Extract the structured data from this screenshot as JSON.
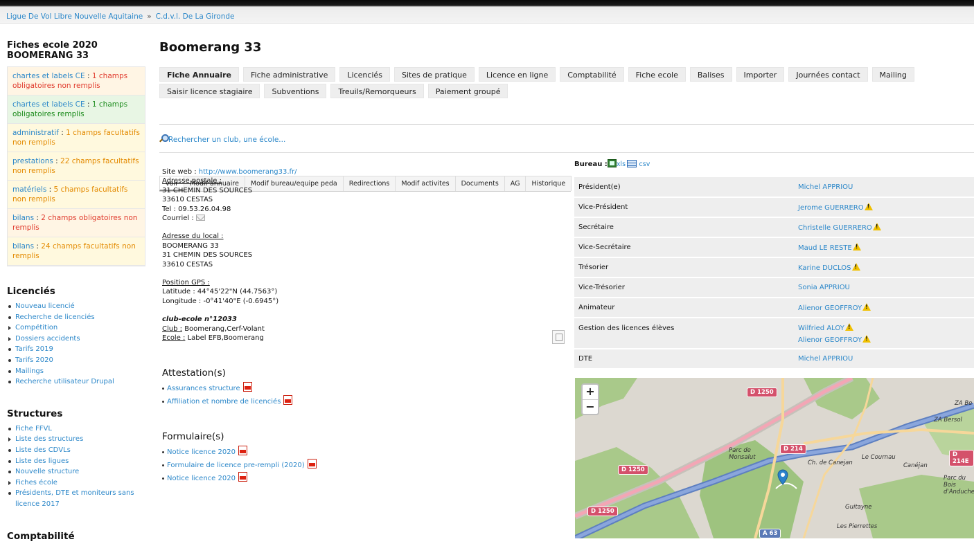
{
  "breadcrumb": {
    "items": [
      "Ligue De Vol Libre Nouvelle Aquitaine",
      "C.d.v.l. De La Gironde"
    ],
    "separator": "»"
  },
  "sidebar": {
    "title_line1": "Fiches ecole 2020",
    "title_line2": "BOOMERANG 33",
    "status": [
      {
        "key": "chartes et labels CE",
        "value": "1 champs obligatoires non remplis",
        "tone": "red"
      },
      {
        "key": "chartes et labels CE",
        "value": "1 champs obligatoires remplis",
        "tone": "green"
      },
      {
        "key": "administratif",
        "value": "1 champs facultatifs non remplis",
        "tone": "yellow"
      },
      {
        "key": "prestations",
        "value": "22 champs facultatifs non remplis",
        "tone": "yellow"
      },
      {
        "key": "matériels",
        "value": "5 champs facultatifs non remplis",
        "tone": "yellow"
      },
      {
        "key": "bilans",
        "value": "2 champs obligatoires non remplis",
        "tone": "red"
      },
      {
        "key": "bilans",
        "value": "24 champs facultatifs non remplis",
        "tone": "yellow"
      }
    ],
    "sections": [
      {
        "title": "Licenciés",
        "items": [
          {
            "label": "Nouveau licencié",
            "marker": "bullet"
          },
          {
            "label": "Recherche de licenciés",
            "marker": "bullet"
          },
          {
            "label": "Compétition",
            "marker": "triangle"
          },
          {
            "label": "Dossiers accidents",
            "marker": "triangle"
          },
          {
            "label": "Tarifs 2019",
            "marker": "bullet"
          },
          {
            "label": "Tarifs 2020",
            "marker": "bullet"
          },
          {
            "label": "Mailings",
            "marker": "bullet"
          },
          {
            "label": "Recherche utilisateur Drupal",
            "marker": "bullet"
          }
        ]
      },
      {
        "title": "Structures",
        "items": [
          {
            "label": "Fiche FFVL",
            "marker": "bullet"
          },
          {
            "label": "Liste des structures",
            "marker": "triangle"
          },
          {
            "label": "Liste des CDVLs",
            "marker": "bullet"
          },
          {
            "label": "Liste des ligues",
            "marker": "bullet"
          },
          {
            "label": "Nouvelle structure",
            "marker": "bullet"
          },
          {
            "label": "Fiches école",
            "marker": "triangle"
          },
          {
            "label": "Présidents, DTE et moniteurs sans licence 2017",
            "marker": "bullet"
          }
        ]
      },
      {
        "title": "Comptabilité",
        "items": []
      }
    ]
  },
  "main": {
    "title": "Boomerang 33",
    "tabs_row1": [
      "Fiche Annuaire",
      "Fiche administrative",
      "Licenciés",
      "Sites de pratique",
      "Licence en ligne",
      "Comptabilité",
      "Fiche ecole",
      "Balises",
      "Importer",
      "Journées contact",
      "Mailing"
    ],
    "tabs_row2": [
      "Saisir licence stagiaire",
      "Subventions",
      "Treuils/Remorqueurs",
      "Paiement groupé"
    ],
    "active_tab": "Fiche Annuaire",
    "subtabs": [
      "voir",
      "Modif annuaire",
      "Modif bureau/equipe peda",
      "Redirections",
      "Modif activites",
      "Documents",
      "AG",
      "Historique"
    ],
    "active_subtab": "voir",
    "search_link": "Rechercher un club, une école..."
  },
  "info": {
    "website_label": "Site web :",
    "website": "http://www.boomerang33.fr/",
    "postal_label": "Adresse postale :",
    "postal": [
      "31 CHEMIN DES SOURCES",
      "33610 CESTAS"
    ],
    "tel": "Tel : 09.53.26.04.98",
    "courriel_label": "Courriel :",
    "local_label": "Adresse du local :",
    "local": [
      "BOOMERANG 33",
      "31 CHEMIN DES SOURCES",
      "33610 CESTAS"
    ],
    "gps_label": "Position GPS :",
    "latitude": "Latitude : 44°45'22\"N (44.7563°)",
    "longitude": "Longitude : -0°41'40\"E (-0.6945°)",
    "club_ecole": "club-ecole n°12033",
    "club_label": "Club :",
    "club_value": "Boomerang,Cerf-Volant",
    "ecole_label": "Ecole :",
    "ecole_value": "Label EFB,Boomerang",
    "attestations_title": "Attestation(s)",
    "attestations": [
      "Assurances structure",
      "Affiliation et nombre de licenciés"
    ],
    "formulaires_title": "Formulaire(s)",
    "formulaires": [
      "Notice licence 2020",
      "Formulaire de licence pre-rempli (2020)",
      "Notice licence 2020"
    ]
  },
  "bureau": {
    "label": "Bureau :",
    "xls": "xls",
    "csv": "csv",
    "rows": [
      {
        "role": "Président(e)",
        "names": [
          {
            "n": "Michel APPRIOU",
            "warn": false
          }
        ]
      },
      {
        "role": "Vice-Président",
        "names": [
          {
            "n": "Jerome GUERRERO",
            "warn": true
          }
        ]
      },
      {
        "role": "Secrétaire",
        "names": [
          {
            "n": "Christelle GUERRERO",
            "warn": true
          }
        ]
      },
      {
        "role": "Vice-Secrétaire",
        "names": [
          {
            "n": "Maud LE RESTE",
            "warn": true
          }
        ]
      },
      {
        "role": "Trésorier",
        "names": [
          {
            "n": "Karine DUCLOS",
            "warn": true
          }
        ]
      },
      {
        "role": "Vice-Trésorier",
        "names": [
          {
            "n": "Sonia APPRIOU",
            "warn": false
          }
        ]
      },
      {
        "role": "Animateur",
        "names": [
          {
            "n": "Alienor GEOFFROY",
            "warn": true
          }
        ]
      },
      {
        "role": "Gestion des licences élèves",
        "names": [
          {
            "n": "Wilfried ALOY",
            "warn": true
          },
          {
            "n": "Alienor GEOFFROY",
            "warn": true
          }
        ]
      },
      {
        "role": "DTE",
        "names": [
          {
            "n": "Michel APPRIOU",
            "warn": false
          }
        ]
      }
    ]
  },
  "map": {
    "zoom_in": "+",
    "zoom_out": "−",
    "labels": [
      "D 1250",
      "D 1250",
      "D 1250",
      "D 214",
      "D 214E",
      "A 63",
      "Parc de Monsalut",
      "Canéjan",
      "Le Cournau",
      "Parc du Bois d'Anduche",
      "ZA Bersol",
      "ZA Be",
      "Ch. de Canejan",
      "Guitayne",
      "Les Pierrettes"
    ],
    "colors": {
      "forest": "#a9c98a",
      "urban": "#e2ddd6",
      "motorway": "#7f9fd3",
      "primary": "#f6d79a"
    }
  }
}
